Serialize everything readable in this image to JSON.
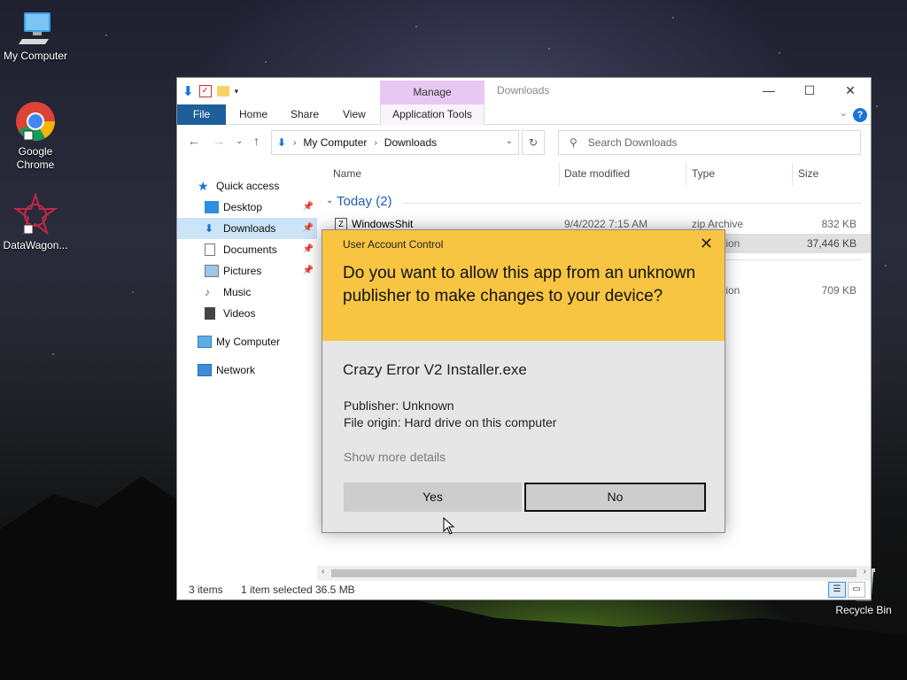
{
  "desktop": {
    "icons": [
      {
        "label": "My Computer"
      },
      {
        "label": "Google Chrome"
      },
      {
        "label": "DataWagon..."
      },
      {
        "label": "Recycle Bin"
      }
    ]
  },
  "explorer": {
    "title": "Downloads",
    "context_tab": "Manage",
    "ribbon_tabs": {
      "file": "File",
      "home": "Home",
      "share": "Share",
      "view": "View",
      "app_tools": "Application Tools"
    },
    "help": "?",
    "address": {
      "crumbs": [
        "My Computer",
        "Downloads"
      ]
    },
    "search": {
      "placeholder": "Search Downloads"
    },
    "sidebar": {
      "quick_access": "Quick access",
      "items": [
        {
          "label": "Desktop"
        },
        {
          "label": "Downloads"
        },
        {
          "label": "Documents"
        },
        {
          "label": "Pictures"
        },
        {
          "label": "Music"
        },
        {
          "label": "Videos"
        }
      ],
      "my_computer": "My Computer",
      "network": "Network"
    },
    "columns": {
      "name": "Name",
      "date": "Date modified",
      "type": "Type",
      "size": "Size"
    },
    "group": "Today (2)",
    "files": [
      {
        "name": "WindowsShit",
        "date": "9/4/2022 7:15 AM",
        "type": "zip Archive",
        "size": "832 KB"
      },
      {
        "name": "",
        "date": "",
        "type": "tion",
        "size": "37,446 KB"
      },
      {
        "name": "",
        "date": "",
        "type": "tion",
        "size": "709 KB"
      }
    ],
    "status": {
      "items": "3 items",
      "selected": "1 item selected",
      "size": "36.5 MB"
    }
  },
  "uac": {
    "title": "User Account Control",
    "question": "Do you want to allow this app from an unknown publisher to make changes to your device?",
    "app_name": "Crazy Error V2 Installer.exe",
    "publisher": "Publisher: Unknown",
    "origin": "File origin: Hard drive on this computer",
    "more_details": "Show more details",
    "yes": "Yes",
    "no": "No"
  },
  "colors": {
    "uac_banner": "#f8c542",
    "file_tab": "#1f5f99",
    "manage_tab": "#e8c8f2",
    "selection": "#cce4f7"
  }
}
